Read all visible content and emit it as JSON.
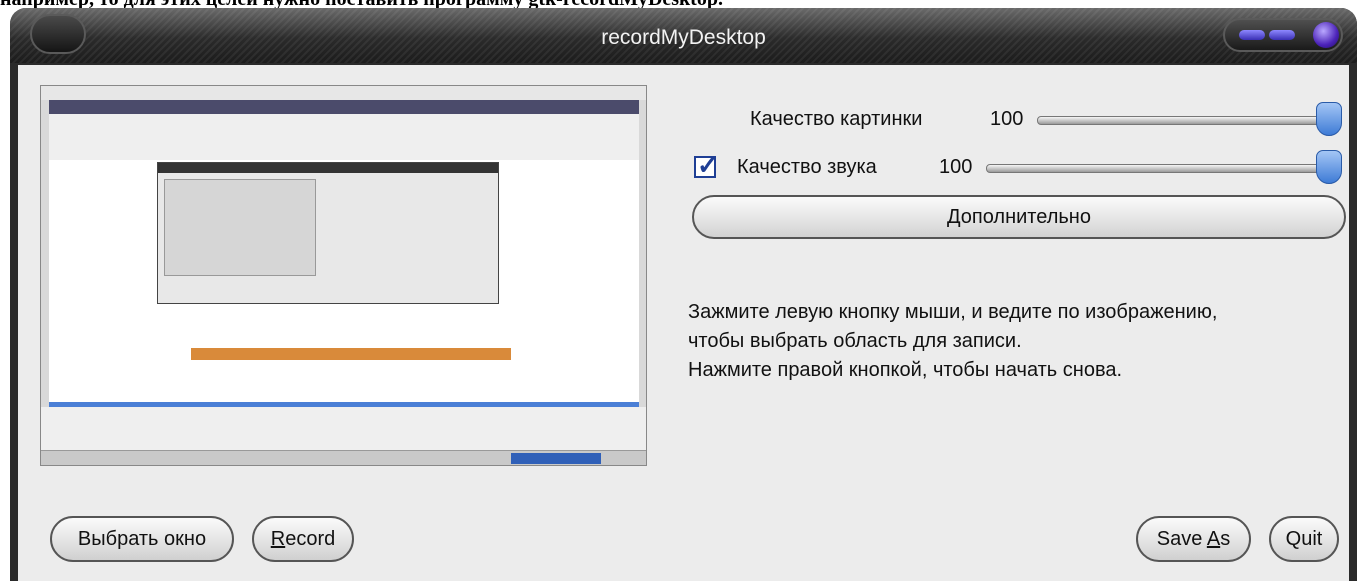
{
  "page_top_text": "например, то для этих целей нужно поставить программу gtk-recordMyDesktop.",
  "window": {
    "title": "recordMyDesktop"
  },
  "settings": {
    "video_quality_label": "Качество картинки",
    "video_quality_value": "100",
    "video_quality_level": 100,
    "sound_enabled": true,
    "sound_quality_label": "Качество звука",
    "sound_quality_value": "100",
    "sound_quality_level": 100,
    "advanced_label": "Дополнительно"
  },
  "instructions": [
    "Зажмите левую кнопку мыши, и ведите по изображению,",
    "чтобы выбрать область для записи.",
    "Нажмите правой кнопкой, чтобы начать снова."
  ],
  "buttons": {
    "select_window": "Выбрать окно",
    "record_mnemonic": "R",
    "record_rest": "ecord",
    "save_as_prefix": "Save ",
    "save_as_mnemonic": "A",
    "save_as_rest": "s",
    "quit": "Quit"
  },
  "colors": {
    "accent": "#3e7bd6",
    "titlebar": "#2b2b2b",
    "panel": "#ececec"
  }
}
